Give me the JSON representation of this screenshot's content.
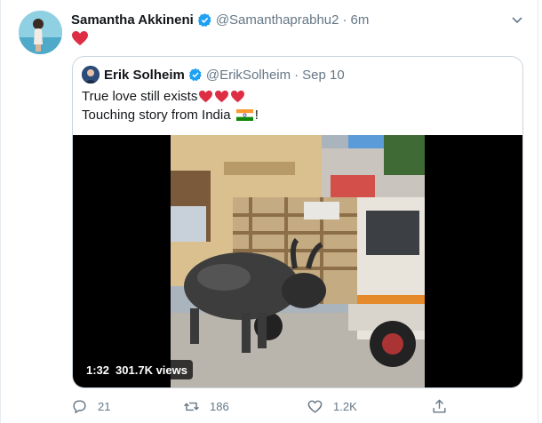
{
  "tweet": {
    "author_name": "Samantha Akkineni",
    "author_handle": "@Samanthaprabhu2",
    "separator": "·",
    "time": "6m",
    "body_emoji": "red-heart-emoji"
  },
  "quoted": {
    "author_name": "Erik Solheim",
    "author_handle": "@ErikSolheim",
    "separator": "·",
    "date": "Sep 10",
    "line1": "True love still exists",
    "line2_prefix": "Touching story from India ",
    "line2_suffix": "!",
    "video": {
      "duration": "1:32",
      "views": "301.7K views"
    }
  },
  "actions": {
    "reply_count": "21",
    "retweet_count": "186",
    "like_count": "1.2K"
  },
  "colors": {
    "verified": "#1da1f2",
    "heart": "#e0245e",
    "secondary_text": "#657786",
    "border": "#ccd6dd"
  },
  "icons": {
    "verified": "verified-badge-icon",
    "caret": "chevron-down-icon",
    "reply": "reply-icon",
    "retweet": "retweet-icon",
    "like": "like-heart-icon",
    "share": "share-icon",
    "flag": "india-flag-icon"
  }
}
